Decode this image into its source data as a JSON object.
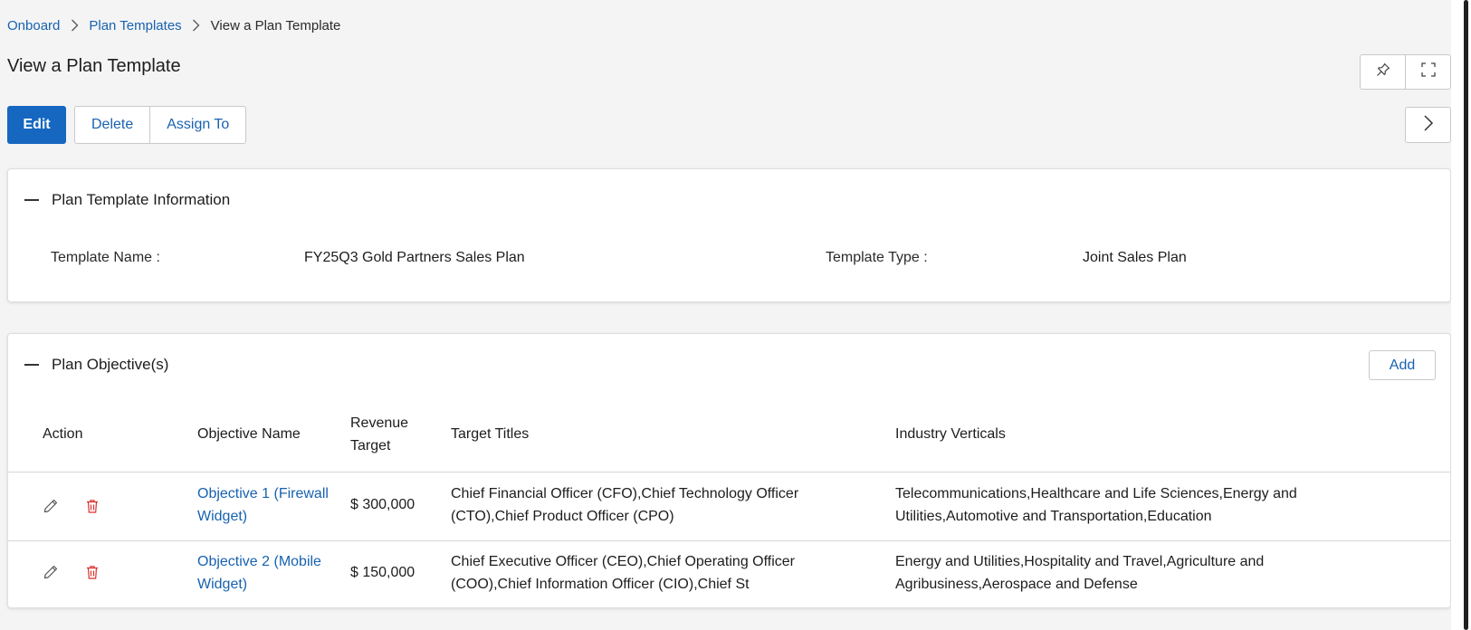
{
  "breadcrumb": {
    "items": [
      "Onboard",
      "Plan Templates"
    ],
    "current": "View a Plan Template"
  },
  "page_title": "View a Plan Template",
  "toolbar": {
    "edit_label": "Edit",
    "delete_label": "Delete",
    "assign_label": "Assign To"
  },
  "info_section": {
    "title": "Plan Template Information",
    "template_name_label": "Template Name :",
    "template_name_value": "FY25Q3 Gold Partners Sales Plan",
    "template_type_label": "Template Type :",
    "template_type_value": "Joint Sales Plan"
  },
  "objectives_section": {
    "title": "Plan Objective(s)",
    "add_label": "Add",
    "columns": {
      "action": "Action",
      "objective_name": "Objective Name",
      "revenue_target_1": "Revenue",
      "revenue_target_2": "Target",
      "target_titles": "Target Titles",
      "industry_verticals": "Industry Verticals"
    },
    "rows": [
      {
        "name_1": "Objective 1 (Firewall",
        "name_2": "Widget)",
        "revenue": "$ 300,000",
        "titles_1": "Chief Financial Officer (CFO),Chief Technology Officer",
        "titles_2": "(CTO),Chief Product Officer (CPO)",
        "industries_1": "Telecommunications,Healthcare and Life Sciences,Energy and",
        "industries_2": "Utilities,Automotive and Transportation,Education"
      },
      {
        "name_1": "Objective 2 (Mobile",
        "name_2": "Widget)",
        "revenue": "$ 150,000",
        "titles_1": "Chief Executive Officer (CEO),Chief Operating Officer",
        "titles_2": "(COO),Chief Information Officer (CIO),Chief St",
        "industries_1": "Energy and Utilities,Hospitality and Travel,Agriculture and",
        "industries_2": "Agribusiness,Aerospace and Defense"
      }
    ]
  },
  "icons": {
    "breadcrumb_separator": "chevron-right-icon",
    "pin": "pin-icon",
    "fullscreen": "expand-icon",
    "next": "chevron-right-icon",
    "collapse": "minus-icon",
    "edit_row": "pencil-icon",
    "delete_row": "trash-icon"
  },
  "colors": {
    "primary": "#1567c0",
    "link": "#1862b0",
    "danger": "#d9302b"
  }
}
